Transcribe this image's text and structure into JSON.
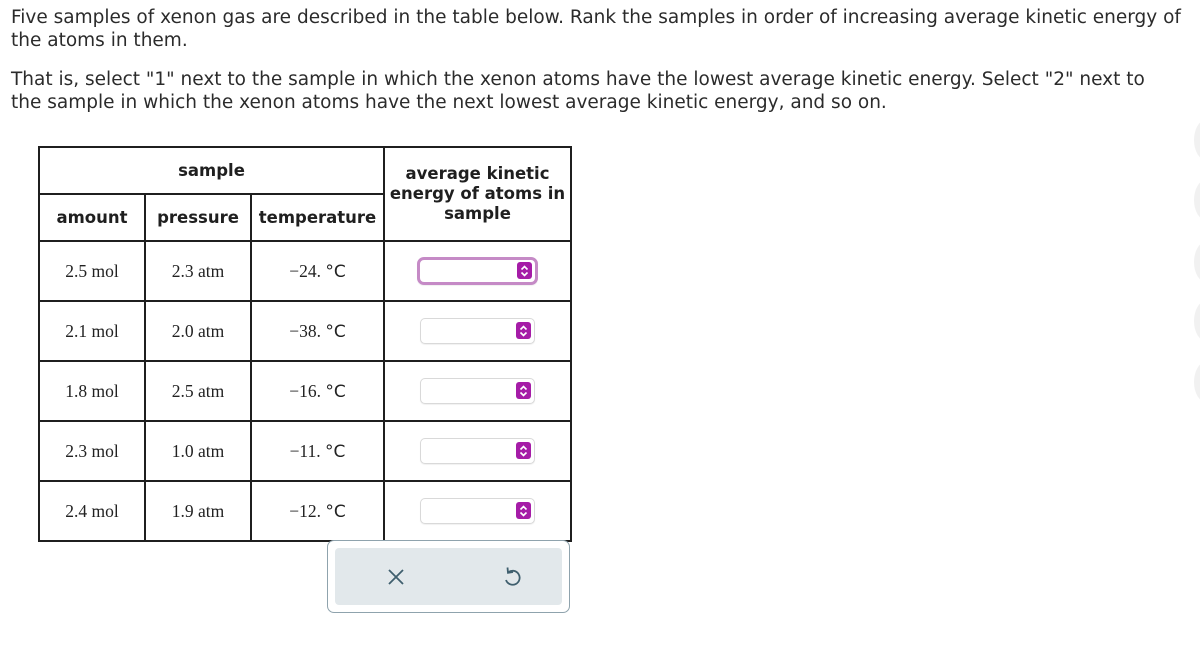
{
  "prompt": {
    "paragraph1": "Five samples of xenon gas are described in the table below. Rank the samples in order of increasing average kinetic energy of the atoms in them.",
    "paragraph2": "That is, select \"1\" next to the sample in which the xenon atoms have the lowest average kinetic energy. Select \"2\" next to the sample in which the xenon atoms have the next lowest average kinetic energy, and so on."
  },
  "table": {
    "group_header": "sample",
    "columns": {
      "amount": "amount",
      "pressure": "pressure",
      "temperature": "temperature",
      "kinetic_energy": "average kinetic energy of atoms in sample"
    },
    "rows": [
      {
        "amount": "2.5 mol",
        "pressure": "2.3 atm",
        "temp_value": "−24.",
        "temp_unit": "°C",
        "rank": ""
      },
      {
        "amount": "2.1 mol",
        "pressure": "2.0 atm",
        "temp_value": "−38.",
        "temp_unit": "°C",
        "rank": ""
      },
      {
        "amount": "1.8 mol",
        "pressure": "2.5 atm",
        "temp_value": "−16.",
        "temp_unit": "°C",
        "rank": ""
      },
      {
        "amount": "2.3 mol",
        "pressure": "1.0 atm",
        "temp_value": "−11.",
        "temp_unit": "°C",
        "rank": ""
      },
      {
        "amount": "2.4 mol",
        "pressure": "1.9 atm",
        "temp_value": "−12.",
        "temp_unit": "°C",
        "rank": ""
      }
    ]
  },
  "actions": {
    "clear_icon": "x-icon",
    "undo_icon": "undo-icon"
  },
  "colors": {
    "select_accent": "#a51ca7",
    "focus_ring": "#c58ac6",
    "action_bg": "#e2e8eb",
    "action_icon": "#3f5f6e"
  }
}
